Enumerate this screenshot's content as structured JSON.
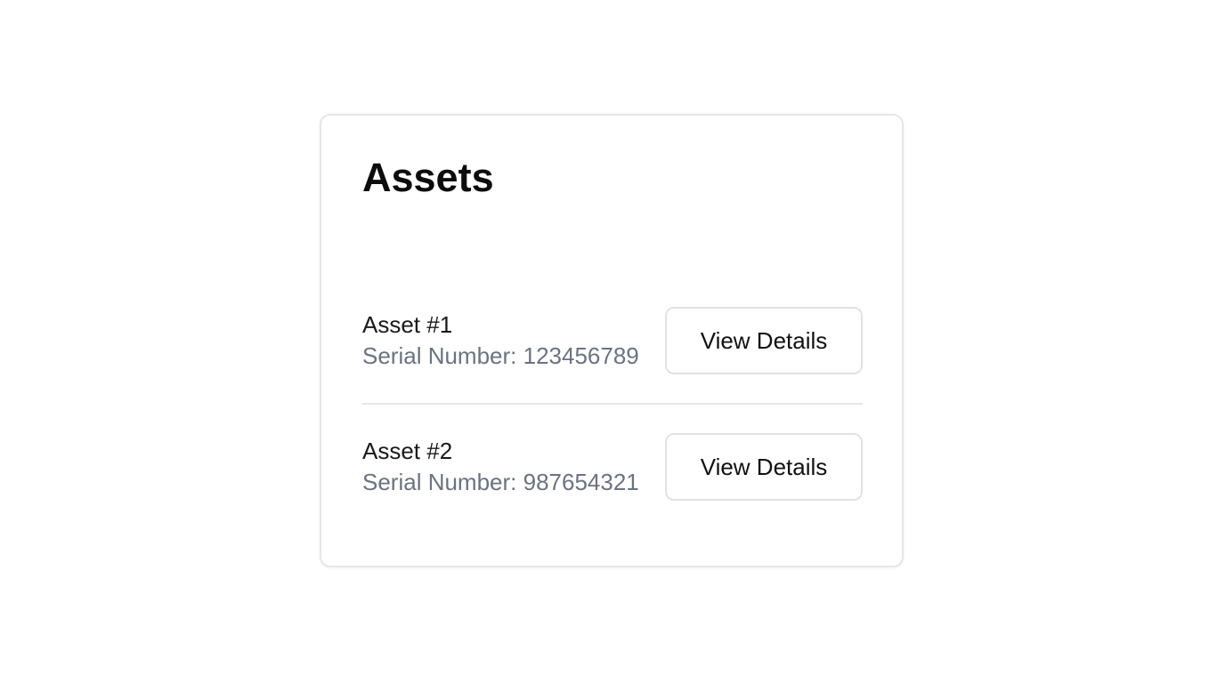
{
  "card": {
    "title": "Assets"
  },
  "assets": [
    {
      "name": "Asset #1",
      "serial": "Serial Number: 123456789",
      "button_label": "View Details"
    },
    {
      "name": "Asset #2",
      "serial": "Serial Number: 987654321",
      "button_label": "View Details"
    }
  ]
}
